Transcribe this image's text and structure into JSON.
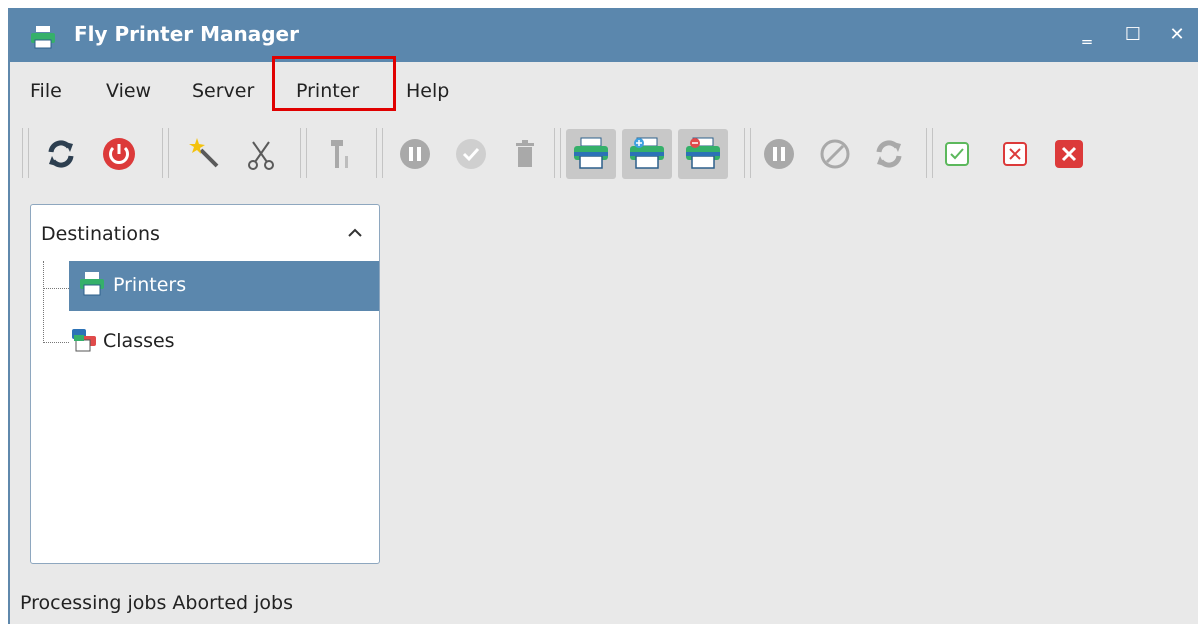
{
  "window": {
    "title": "Fly Printer Manager",
    "controls": {
      "minimize": "‗",
      "maximize": "☐",
      "close": "✕"
    }
  },
  "menubar": {
    "items": [
      "File",
      "View",
      "Server",
      "Printer",
      "Help"
    ],
    "highlighted_item": "Printer",
    "highlight_color": "#e00000"
  },
  "toolbar": {
    "buttons": [
      {
        "icon": "refresh-icon",
        "enabled": true
      },
      {
        "icon": "power-icon",
        "enabled": true
      },
      {
        "icon": "magic-wand-icon",
        "enabled": true
      },
      {
        "icon": "scissors-icon",
        "enabled": true
      },
      {
        "icon": "tools-icon",
        "enabled": false
      },
      {
        "icon": "pause-icon",
        "enabled": false
      },
      {
        "icon": "check-circle-icon",
        "enabled": false
      },
      {
        "icon": "trash-icon",
        "enabled": false
      },
      {
        "icon": "printer-icon",
        "enabled": true,
        "pressed": true
      },
      {
        "icon": "printer-add-icon",
        "enabled": true,
        "pressed": true
      },
      {
        "icon": "printer-remove-icon",
        "enabled": true,
        "pressed": true
      },
      {
        "icon": "pause-icon",
        "enabled": false
      },
      {
        "icon": "cancel-icon",
        "enabled": false
      },
      {
        "icon": "refresh-icon",
        "enabled": false
      },
      {
        "icon": "checkbox-checked-icon",
        "enabled": true
      },
      {
        "icon": "checkbox-x-icon",
        "enabled": true
      },
      {
        "icon": "close-red-icon",
        "enabled": true
      }
    ]
  },
  "panel": {
    "title": "Destinations",
    "items": [
      {
        "label": "Printers",
        "icon": "printer-icon",
        "selected": true
      },
      {
        "label": "Classes",
        "icon": "printer-class-icon",
        "selected": false
      }
    ]
  },
  "statusbar": {
    "items": [
      "Processing jobs",
      "Aborted jobs"
    ]
  },
  "colors": {
    "titlebar": "#5b87ad",
    "selection": "#5b87ad",
    "window_bg": "#e9e9e9"
  }
}
